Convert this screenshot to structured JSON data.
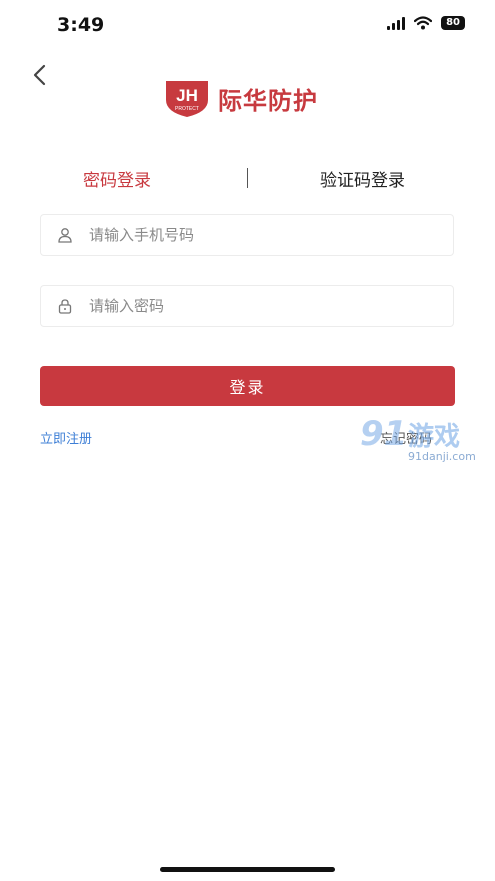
{
  "status_bar": {
    "time": "3:49",
    "battery": "80"
  },
  "header": {
    "brand_name": "际华防护",
    "logo_letters": "JH",
    "logo_subtext": "PROTECT",
    "brand_color": "#c73a3f"
  },
  "tabs": [
    {
      "label": "密码登录",
      "active": true
    },
    {
      "label": "验证码登录",
      "active": false
    }
  ],
  "form": {
    "phone_placeholder": "请输入手机号码",
    "phone_value": "",
    "password_placeholder": "请输入密码",
    "password_value": ""
  },
  "login_button": {
    "label": "登录"
  },
  "links": {
    "register": "立即注册",
    "forgot": "忘记密码"
  },
  "watermark": {
    "number": "91",
    "name": "游戏",
    "url": "91danji.com"
  },
  "icons": [
    "back-chevron-icon",
    "user-icon",
    "lock-icon",
    "signal-icon",
    "wifi-icon",
    "battery-icon"
  ],
  "colors": {
    "accent": "#c8393f",
    "link": "#3e7fd6"
  }
}
